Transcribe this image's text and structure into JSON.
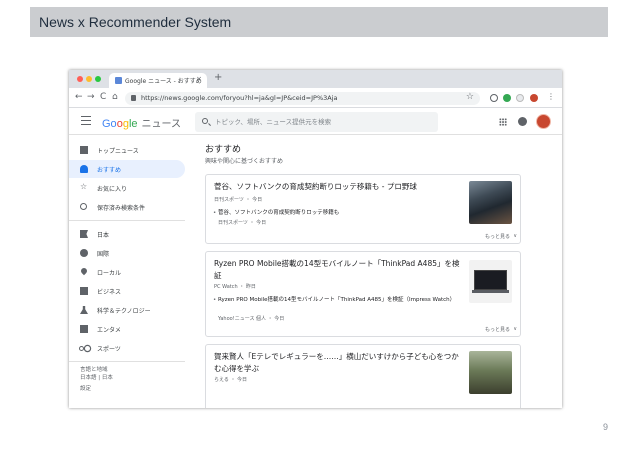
{
  "slide": {
    "title": "News x Recommender System",
    "page_number": "9"
  },
  "browser": {
    "traffic_lights": [
      "#ff5f57",
      "#febc2e",
      "#28c840"
    ],
    "tab_title": "Google ニュース - おすすめ",
    "tab_close": "×",
    "new_tab": "+",
    "nav": {
      "back": "←",
      "forward": "→",
      "reload": "C",
      "home": "⌂"
    },
    "url": "https://news.google.com/foryou?hl=ja&gl=JP&ceid=JP%3Aja",
    "bookmark_star": "☆"
  },
  "gnews": {
    "logo": {
      "g1": "Go",
      "g2": "o",
      "g3": "g",
      "g4": "le",
      "product": "ニュース"
    },
    "search_placeholder": "トピック、場所、ニュース提供元を検索"
  },
  "sidebar": {
    "items": [
      {
        "label": "トップニュース",
        "icon": "top-news-icon",
        "active": false
      },
      {
        "label": "おすすめ",
        "icon": "person-icon",
        "active": true
      },
      {
        "label": "お気に入り",
        "icon": "star-icon",
        "active": false
      },
      {
        "label": "保存済み検索条件",
        "icon": "search-icon",
        "active": false
      },
      {
        "label": "日本",
        "icon": "flag-icon",
        "active": false
      },
      {
        "label": "国際",
        "icon": "globe-icon",
        "active": false
      },
      {
        "label": "ローカル",
        "icon": "location-pin-icon",
        "active": false
      },
      {
        "label": "ビジネス",
        "icon": "building-icon",
        "active": false
      },
      {
        "label": "科学＆テクノロジー",
        "icon": "flask-icon",
        "active": false
      },
      {
        "label": "エンタメ",
        "icon": "film-icon",
        "active": false
      },
      {
        "label": "スポーツ",
        "icon": "bike-icon",
        "active": false
      }
    ],
    "footer": [
      "言語と地域",
      "日本語 | 日本",
      "設定"
    ]
  },
  "main": {
    "title": "おすすめ",
    "subtitle": "興味や関心に基づくおすすめ",
    "more_label": "もっと見る",
    "chevron": "∨",
    "cards": [
      {
        "headline": "菅谷、ソフトバンクの育成契約断りロッテ移籍も - プロ野球",
        "source": "日刊スポーツ ・ 今日",
        "related": "菅谷、ソフトバンクの育成契約断りロッテ移籍も",
        "related_source": "日刊スポーツ ・ 今日",
        "thumb": "baseball-photo"
      },
      {
        "headline": "Ryzen PRO Mobile搭載の14型モバイルノート「ThinkPad A485」を検証",
        "source": "PC Watch ・ 昨日",
        "related": "Ryzen PRO Mobile搭載の14型モバイルノート「ThinkPad A485」を検証（Impress Watch）",
        "related_source": "Yahoo!ニュース 個人 ・ 今日",
        "thumb": "laptop-photo"
      },
      {
        "headline": "賀来賢人「Eテレでレギュラーを……」横山だいすけから子ども心をつかむ心得を学ぶ",
        "source": "らえる ・ 今日",
        "thumb": "people-photo"
      }
    ]
  }
}
